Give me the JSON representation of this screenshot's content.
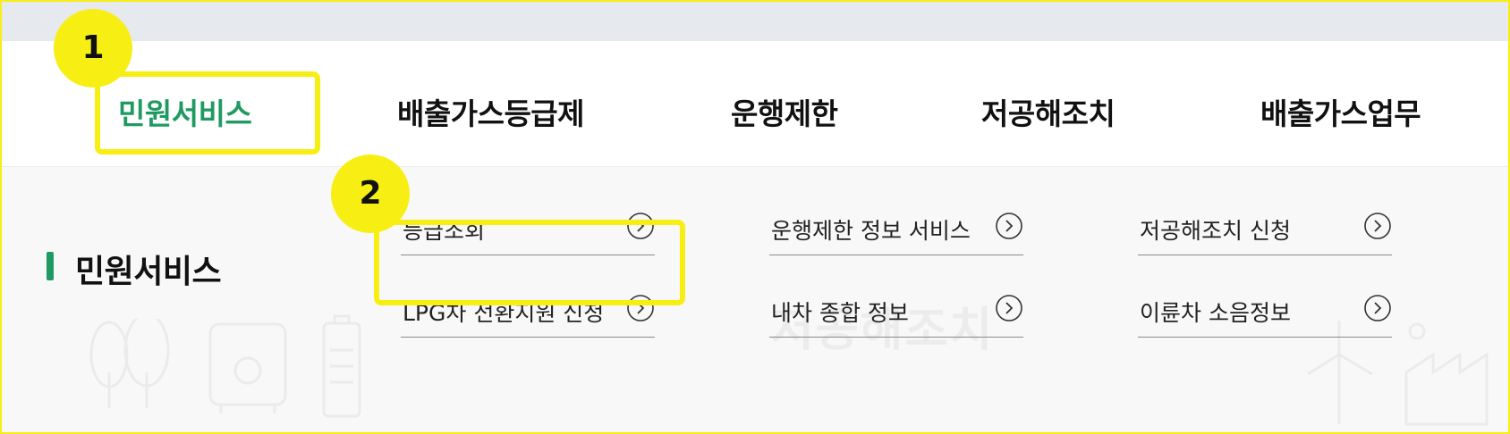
{
  "gnb": {
    "items": [
      {
        "label": "민원서비스",
        "active": true
      },
      {
        "label": "배출가스등급제"
      },
      {
        "label": "운행제한"
      },
      {
        "label": "저공해조치"
      },
      {
        "label": "배출가스업무"
      }
    ]
  },
  "submenu": {
    "title": "민원서비스",
    "watermark": "저공해조치",
    "links": [
      {
        "label": "등급조회"
      },
      {
        "label": "운행제한 정보 서비스"
      },
      {
        "label": "저공해조치 신청"
      },
      {
        "label": "LPG차 전환지원 신청"
      },
      {
        "label": "내차 종합 정보"
      },
      {
        "label": "이륜차 소음정보"
      }
    ]
  },
  "annotations": {
    "badge1": "1",
    "badge2": "2",
    "highlight_color": "#f7ef14"
  },
  "colors": {
    "accent": "#1f9a63",
    "top_strip": "#e6e9ee",
    "panel_bg": "#f8f8f8"
  }
}
